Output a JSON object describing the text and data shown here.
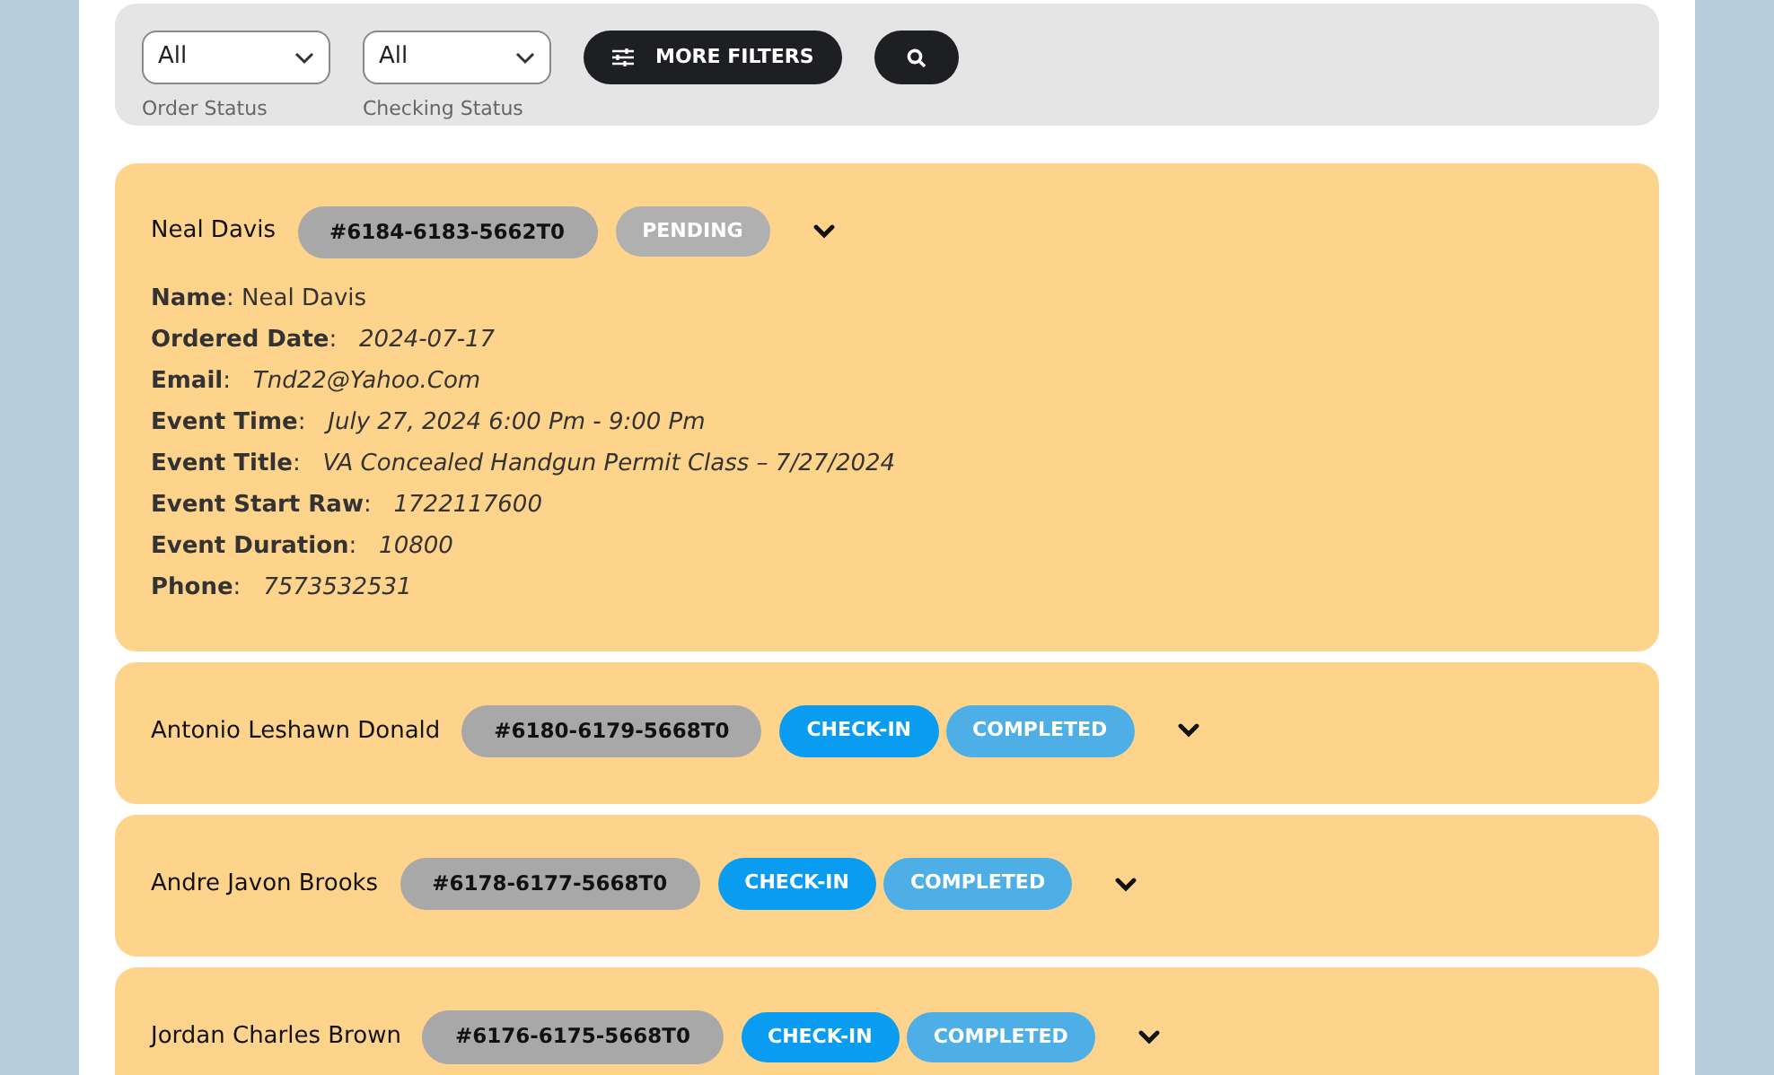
{
  "filters": {
    "selects": [
      {
        "value": "All",
        "label": "Order Status"
      },
      {
        "value": "All",
        "label": "Checking Status"
      }
    ],
    "more_filters": "MORE FILTERS"
  },
  "orders": [
    {
      "name": "Neal Davis",
      "number": "#6184-6183-5662T0",
      "badges": [
        {
          "kind": "pending",
          "label": "PENDING"
        }
      ],
      "details": [
        "**Name**: Neal Davis",
        "**Ordered Date**:   *2024-07-17*",
        "**Email**:   *Tnd22@Yahoo.Com*",
        "**Event Time**:   *July 27, 2024 6:00 Pm - 9:00 Pm*",
        "**Event Title**:   *VA Concealed Handgun Permit Class – 7/27/2024*",
        "**Event Start Raw**:   *1722117600*",
        "**Event Duration**:   *10800*",
        "**Phone**:   *7573532531*"
      ]
    },
    {
      "name": "Antonio Leshawn Donald",
      "number": "#6180-6179-5668T0",
      "badges": [
        {
          "kind": "check-in",
          "label": "CHECK-IN"
        },
        {
          "kind": "completed",
          "label": "COMPLETED"
        }
      ]
    },
    {
      "name": "Andre Javon Brooks",
      "number": "#6178-6177-5668T0",
      "badges": [
        {
          "kind": "check-in",
          "label": "CHECK-IN"
        },
        {
          "kind": "completed",
          "label": "COMPLETED"
        }
      ]
    },
    {
      "name": "Jordan Charles Brown",
      "number": "#6176-6175-5668T0",
      "badges": [
        {
          "kind": "check-in",
          "label": "CHECK-IN"
        },
        {
          "kind": "completed",
          "label": "COMPLETED"
        }
      ]
    }
  ]
}
